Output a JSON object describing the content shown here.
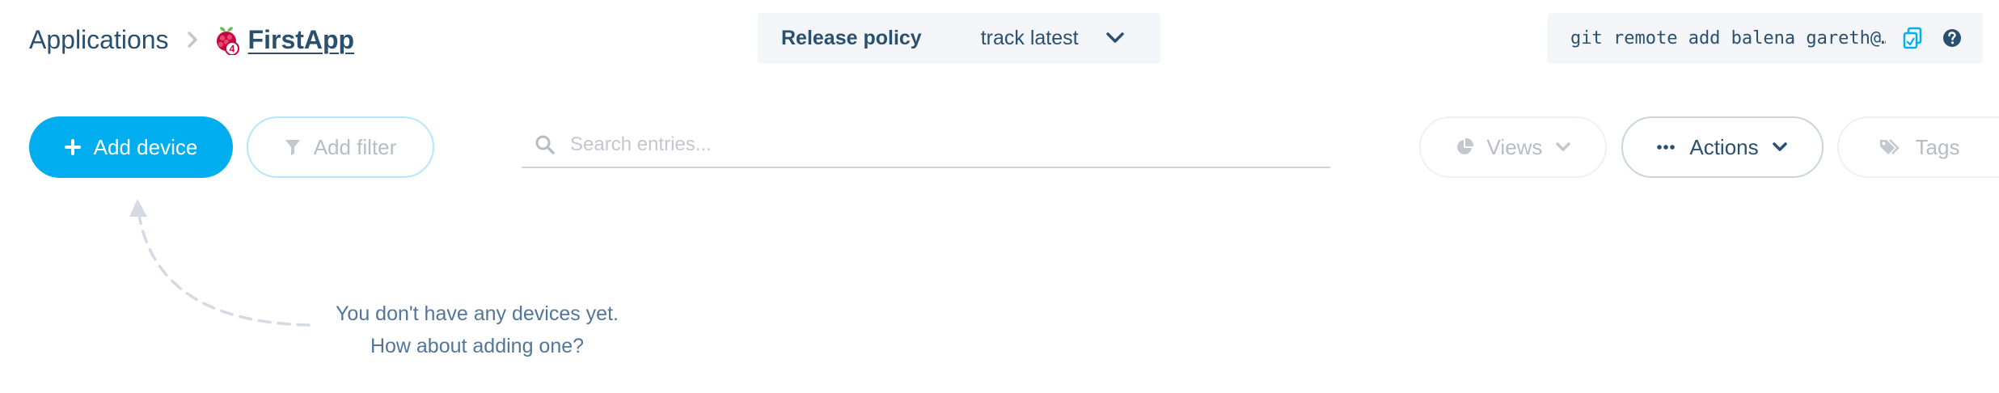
{
  "breadcrumb": {
    "root": "Applications",
    "current": "FirstApp",
    "app_icon": "raspberry-pi-icon",
    "app_icon_badge": "4"
  },
  "release_policy": {
    "label": "Release policy",
    "value": "track latest"
  },
  "git_remote": {
    "command": "git remote add balena gareth@…"
  },
  "toolbar": {
    "add_device_label": "Add device",
    "add_filter_label": "Add filter",
    "search_placeholder": "Search entries...",
    "views_label": "Views",
    "actions_label": "Actions",
    "tags_label": "Tags"
  },
  "empty_state": {
    "line1": "You don't have any devices yet.",
    "line2": "How about adding one?"
  },
  "colors": {
    "primary": "#00aeef",
    "text": "#2a506f",
    "muted": "#b6bcc4",
    "panel": "#f4f5f9"
  }
}
